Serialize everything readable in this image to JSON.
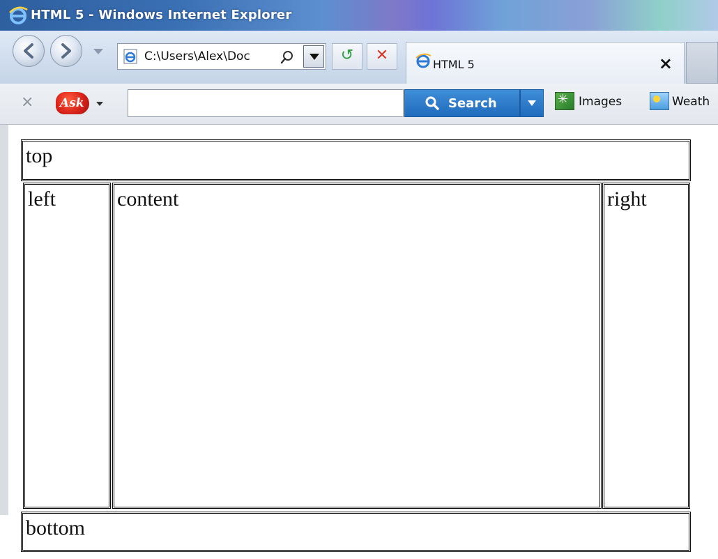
{
  "window": {
    "title": "HTML 5 - Windows Internet Explorer"
  },
  "navbar": {
    "address": "C:\\Users\\Alex\\Doc",
    "tab_label": "HTML 5",
    "tab_close": "×"
  },
  "toolbar": {
    "close": "×",
    "ask_logo": "Ask",
    "search_value": "",
    "search_button": "Search",
    "images_label": "Images",
    "weather_label": "Weath"
  },
  "page": {
    "top": "top",
    "left": "left",
    "content": "content",
    "right": "right",
    "bottom": "bottom"
  }
}
